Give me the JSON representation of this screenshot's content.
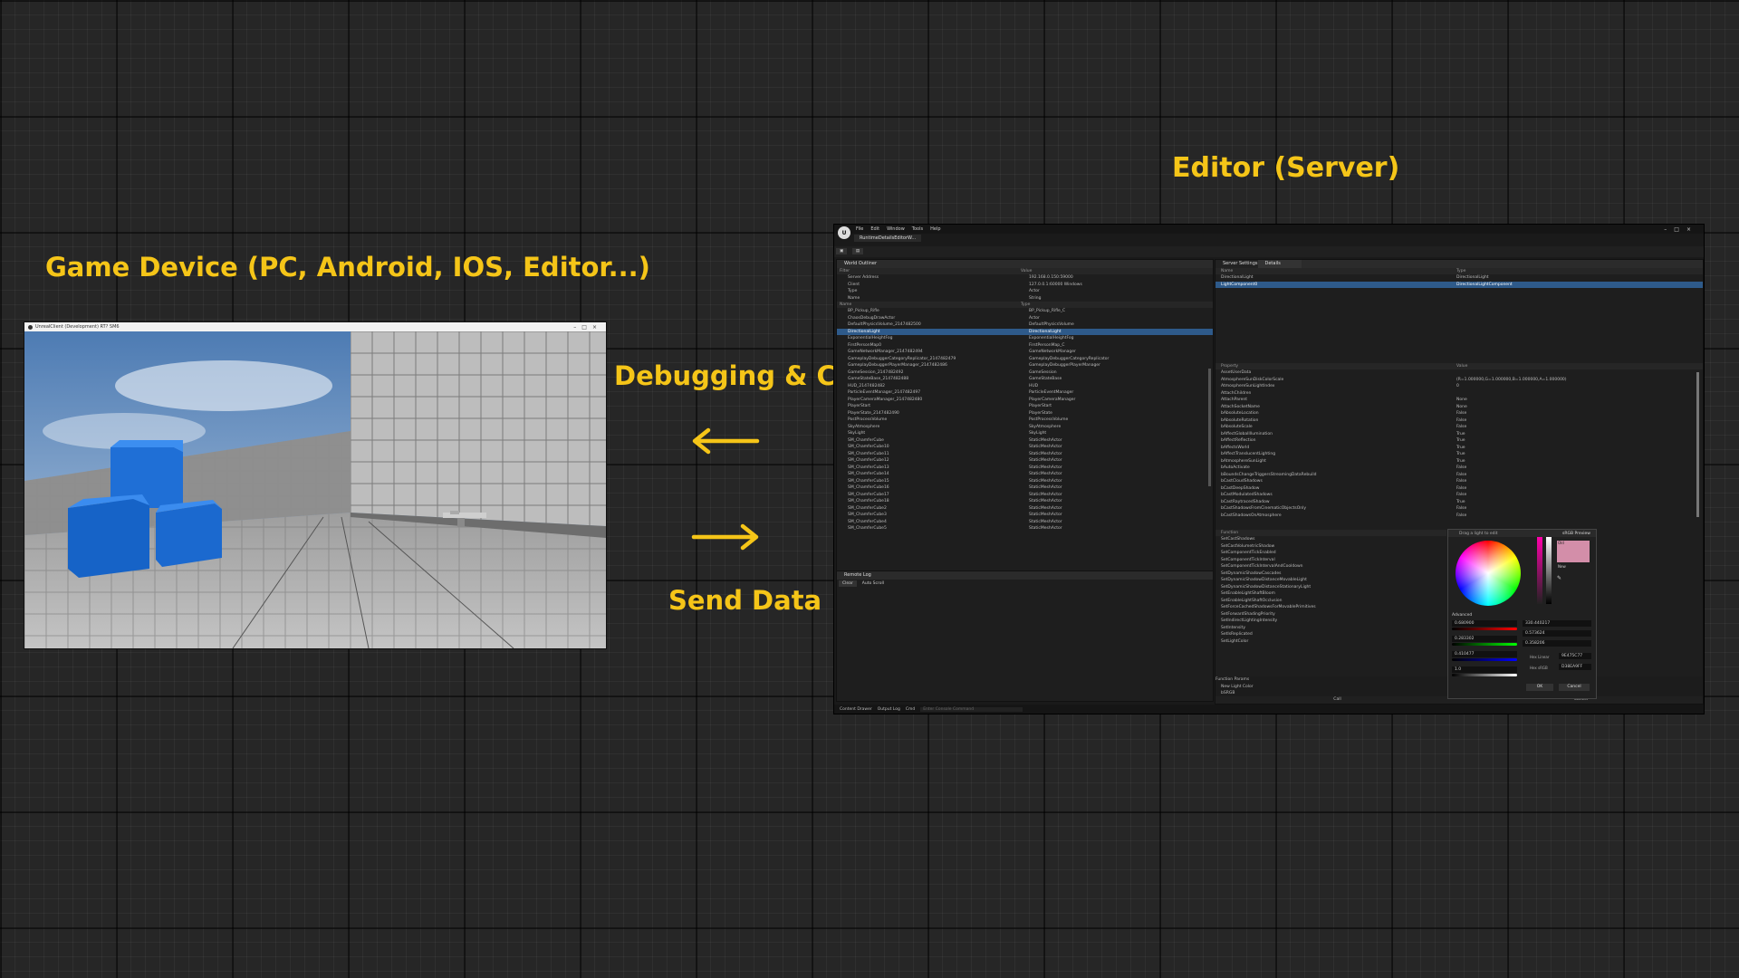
{
  "labels": {
    "editor": "Editor (Server)",
    "game": "Game Device (PC, Android, IOS, Editor...)",
    "debug": "Debugging & Control",
    "send": "Send Data"
  },
  "colors": {
    "accent": "#f5c518",
    "background": "#262626",
    "selection": "#2e5a8a"
  },
  "game_window": {
    "title": "UnrealClient (Development) RT? SM6"
  },
  "editor": {
    "menu": [
      "File",
      "Edit",
      "Window",
      "Tools",
      "Help"
    ],
    "tab": "RuntimeDetailsEditorW...",
    "outliner": {
      "tab": "World Outliner",
      "filter_header": [
        "Filter",
        "Value"
      ],
      "filters": [
        [
          "Server Address",
          "192.168.0.150:59000"
        ],
        [
          "Client",
          "127.0.0.1:60000 Windows"
        ],
        [
          "Type",
          "Actor"
        ],
        [
          "Name",
          "String"
        ]
      ],
      "columns": [
        "Name",
        "Type"
      ],
      "rows": [
        [
          "BP_Pickup_Rifle",
          "BP_Pickup_Rifle_C"
        ],
        [
          "ChaosDebugDrawActor",
          "Actor"
        ],
        [
          "DefaultPhysicsVolume_2147482500",
          "DefaultPhysicsVolume"
        ],
        [
          "DirectionalLight",
          "DirectionalLight"
        ],
        [
          "ExponentialHeightFog",
          "ExponentialHeightFog"
        ],
        [
          "FirstPersonMap0",
          "FirstPersonMap_C"
        ],
        [
          "GameNetworkManager_2147482494",
          "GameNetworkManager"
        ],
        [
          "GameplayDebuggerCategoryReplicator_2147482479",
          "GameplayDebuggerCategoryReplicator"
        ],
        [
          "GameplayDebuggerPlayerManager_2147482486",
          "GameplayDebuggerPlayerManager"
        ],
        [
          "GameSession_2147482492",
          "GameSession"
        ],
        [
          "GameStateBase_2147482488",
          "GameStateBase"
        ],
        [
          "HUD_2147482482",
          "HUD"
        ],
        [
          "ParticleEventManager_2147482497",
          "ParticleEventManager"
        ],
        [
          "PlayerCameraManager_2147482480",
          "PlayerCameraManager"
        ],
        [
          "PlayerStart",
          "PlayerStart"
        ],
        [
          "PlayerState_2147482490",
          "PlayerState"
        ],
        [
          "PostProcessVolume",
          "PostProcessVolume"
        ],
        [
          "SkyAtmosphere",
          "SkyAtmosphere"
        ],
        [
          "SkyLight",
          "SkyLight"
        ],
        [
          "SM_ChamferCube",
          "StaticMeshActor"
        ],
        [
          "SM_ChamferCube10",
          "StaticMeshActor"
        ],
        [
          "SM_ChamferCube11",
          "StaticMeshActor"
        ],
        [
          "SM_ChamferCube12",
          "StaticMeshActor"
        ],
        [
          "SM_ChamferCube13",
          "StaticMeshActor"
        ],
        [
          "SM_ChamferCube14",
          "StaticMeshActor"
        ],
        [
          "SM_ChamferCube15",
          "StaticMeshActor"
        ],
        [
          "SM_ChamferCube16",
          "StaticMeshActor"
        ],
        [
          "SM_ChamferCube17",
          "StaticMeshActor"
        ],
        [
          "SM_ChamferCube18",
          "StaticMeshActor"
        ],
        [
          "SM_ChamferCube2",
          "StaticMeshActor"
        ],
        [
          "SM_ChamferCube3",
          "StaticMeshActor"
        ],
        [
          "SM_ChamferCube4",
          "StaticMeshActor"
        ],
        [
          "SM_ChamferCube5",
          "StaticMeshActor"
        ]
      ],
      "selected_index": 3
    },
    "log": {
      "tab": "Remote Log",
      "clear": "Clear",
      "autoscroll": "Auto Scroll"
    },
    "details": {
      "tabs": [
        "Server Settings",
        "Details"
      ],
      "columns": [
        "Name",
        "Type"
      ],
      "rows": [
        [
          "DirectionalLight",
          "DirectionalLight"
        ],
        [
          "LightComponent0",
          "DirectionalLightComponent"
        ]
      ],
      "prop_columns": [
        "Property",
        "Value"
      ],
      "properties": [
        [
          "AssetUserData",
          ""
        ],
        [
          "AtmosphereSunDiskColorScale",
          "(R=1.000000,G=1.000000,B=1.000000,A=1.000000)"
        ],
        [
          "AtmosphereSunLightIndex",
          "0"
        ],
        [
          "AttachChildren",
          ""
        ],
        [
          "AttachParent",
          "None"
        ],
        [
          "AttachSocketName",
          "None"
        ],
        [
          "bAbsoluteLocation",
          "False"
        ],
        [
          "bAbsoluteRotation",
          "False"
        ],
        [
          "bAbsoluteScale",
          "False"
        ],
        [
          "bAffectGlobalIllumination",
          "True"
        ],
        [
          "bAffectReflection",
          "True"
        ],
        [
          "bAffectsWorld",
          "True"
        ],
        [
          "bAffectTranslucentLighting",
          "True"
        ],
        [
          "bAtmosphereSunLight",
          "True"
        ],
        [
          "bAutoActivate",
          "False"
        ],
        [
          "bBoundsChangeTriggersStreamingDataRebuild",
          "False"
        ],
        [
          "bCastCloudShadows",
          "False"
        ],
        [
          "bCastDeepShadow",
          "False"
        ],
        [
          "bCastModulatedShadows",
          "False"
        ],
        [
          "bCastRaytracedShadow",
          "True"
        ],
        [
          "bCastShadowsFromCinematicObjectsOnly",
          "False"
        ],
        [
          "bCastShadowsOnAtmosphere",
          "False"
        ]
      ],
      "func_header": "Function",
      "functions": [
        "SetCastShadows",
        "SetCastVolumetricShadow",
        "SetComponentTickEnabled",
        "SetComponentTickInterval",
        "SetComponentTickIntervalAndCooldown",
        "SetDynamicShadowCascades",
        "SetDynamicShadowDistanceMovableLight",
        "SetDynamicShadowDistanceStationaryLight",
        "SetEnableLightShaftBloom",
        "SetEnableLightShaftOcclusion",
        "SetForceCachedShadowsForMovablePrimitives",
        "SetForwardShadingPriority",
        "SetIndirectLightingIntensity",
        "SetIntensity",
        "SetIsReplicated",
        "SetLightColor"
      ],
      "func_params": "Function Params",
      "param_name": "New Light Color",
      "param_bsrgb": "bSRGB",
      "call": "Call",
      "cancel": "Cancel"
    },
    "picker": {
      "search": "Drag a light to edit",
      "srgb": "sRGB Preview",
      "advanced": "Advanced",
      "old": "Old",
      "new": "New",
      "fields": [
        "0.680900",
        "0.283302",
        "0.410477",
        "1.0"
      ],
      "fields_right": [
        "330.440217",
        "0.573624",
        "0.358206"
      ],
      "hex_linear_label": "Hex Linear",
      "hex_linear": "9E475C77",
      "hex_srgb_label": "Hex sRGB",
      "hex_srgb": "D38EA9FF",
      "ok": "OK",
      "cancel": "Cancel"
    },
    "status": [
      "Content Drawer",
      "Output Log",
      "Cmd"
    ],
    "console_placeholder": "Enter Console Command"
  }
}
